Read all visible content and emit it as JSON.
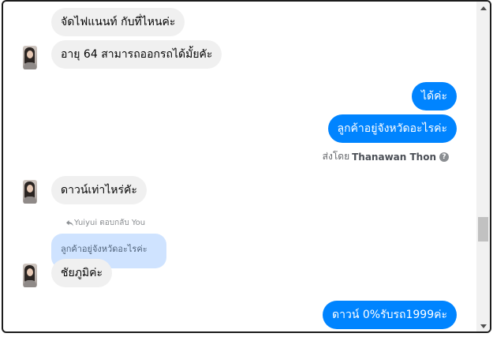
{
  "messages": {
    "m1": "จัดไฟแนนท์ กับที่ไหนค่ะ",
    "m2": "อายุ 64 สามารถออกรถได้มั้ยคัะ",
    "m3": "ได้ค่ะ",
    "m4": "ลูกค้าอยู่จังหวัดอะไรค่ะ",
    "m5": "ดาวน์เท่าไหร่คัะ",
    "m6": "ชัยภูมิค่ะ",
    "m7": "ดาวน์ 0%รับรถ1999ค่ะ"
  },
  "sent_by": {
    "prefix": "ส่งโดย",
    "name": "Thanawan Thon",
    "help_glyph": "?"
  },
  "reply": {
    "meta": "Yuiyui ตอบกลับ You",
    "icon": "reply-arrow-icon",
    "quoted_text": "ลูกค้าอยู่จังหวัดอะไรค่ะ"
  },
  "colors": {
    "outgoing": "#0084ff",
    "incoming": "#f0f0f0",
    "quoted": "#cfe3ff"
  }
}
